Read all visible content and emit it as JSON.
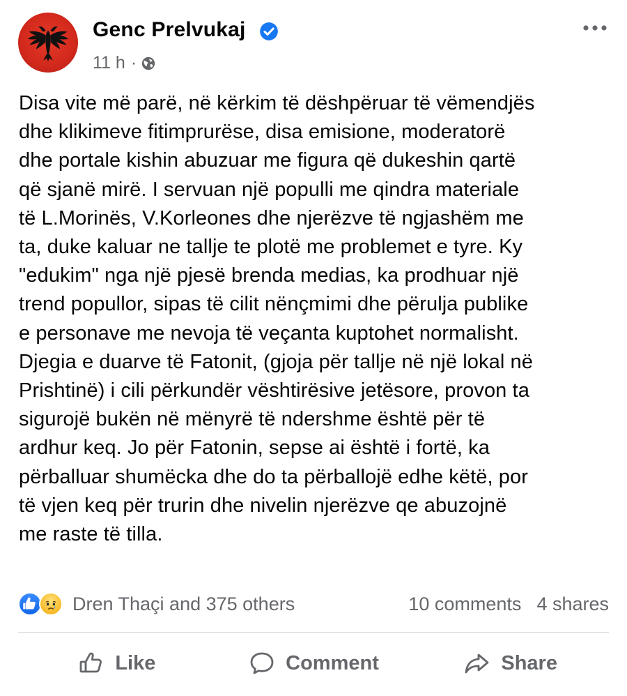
{
  "post": {
    "author": "Genc Prelvukaj",
    "time": "11 h",
    "separator": "·",
    "text": "Disa vite më parë, në kërkim të dëshpëruar të vëmendjës\ndhe klikimeve fitimprurëse, disa emisione, moderatorë\ndhe portale kishin abuzuar me figura që dukeshin qartë\nqë sjanë mirë. I servuan një populli me qindra materiale\ntë L.Morinës, V.Korleones dhe njerëzve të ngjashëm me\nta, duke kaluar ne tallje te plotë me problemet e tyre. Ky\n\"edukim\" nga një pjesë brenda medias, ka prodhuar një\ntrend popullor, sipas të cilit nënçmimi dhe përulja publike\ne personave me nevoja të veçanta kuptohet normalisht.\nDjegia e duarve të Fatonit, (gjoja për tallje në një lokal në\nPrishtinë) i cili përkundër vështirësive jetësore, provon ta\nsigurojë bukën në mënyrë të ndershme është për të\nardhur keq. Jo për Fatonin, sepse ai është i fortë, ka\npërballuar shumëcka dhe do ta përballojë edhe këtë, por\ntë vjen keq për trurin dhe nivelin njerëzve qe abuzojnë\nme raste të tilla."
  },
  "reactions": {
    "icons": [
      "like-icon",
      "sad-icon"
    ],
    "summary": "Dren Thaçi and 375 others",
    "comments": "10 comments",
    "shares": "4 shares"
  },
  "actions": {
    "like": "Like",
    "comment": "Comment",
    "share": "Share"
  },
  "colors": {
    "text": "#050505",
    "secondary": "#65676b",
    "verified": "#1877f2",
    "avatar_bg": "#d42a1d"
  }
}
